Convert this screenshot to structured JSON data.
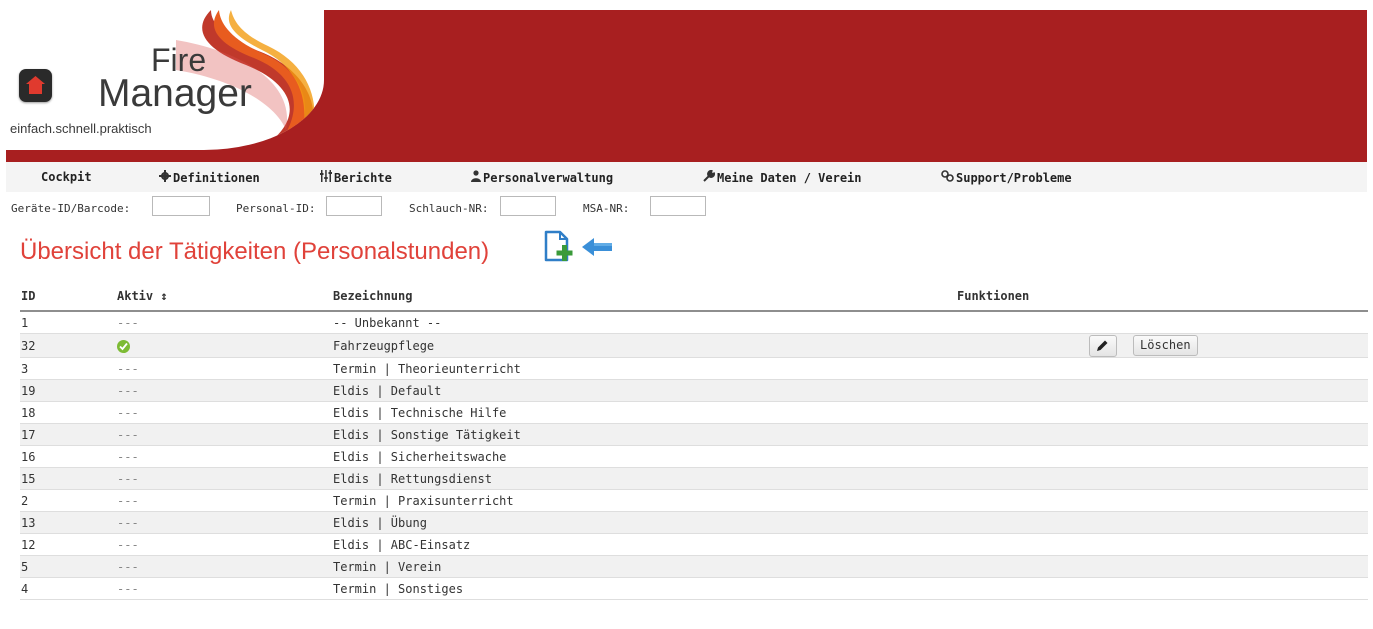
{
  "brand": {
    "line1": "Fire",
    "line2": "Manager",
    "tagline": "einfach.schnell.praktisch"
  },
  "nav": {
    "items": [
      {
        "label": "Cockpit",
        "icon": "none"
      },
      {
        "label": "Definitionen",
        "icon": "gear-icon"
      },
      {
        "label": "Berichte",
        "icon": "sliders-icon"
      },
      {
        "label": "Personalverwaltung",
        "icon": "person-icon"
      },
      {
        "label": "Meine Daten / Verein",
        "icon": "wrench-icon"
      },
      {
        "label": "Support/Probleme",
        "icon": "support-icon"
      }
    ]
  },
  "quick_search": {
    "device_label": "Geräte-ID/Barcode:",
    "device_value": "",
    "personal_label": "Personal-ID:",
    "personal_value": "",
    "hose_label": "Schlauch-NR:",
    "hose_value": "",
    "msa_label": "MSA-NR:",
    "msa_value": ""
  },
  "page": {
    "title": "Übersicht der Tätigkeiten (Personalstunden)"
  },
  "table": {
    "columns": {
      "id": "ID",
      "active": "Aktiv ↕",
      "name": "Bezeichnung",
      "functions": "Funktionen"
    },
    "edit_icon": "pencil-icon",
    "delete_label": "Löschen",
    "rows": [
      {
        "id": "1",
        "active": "---",
        "name": "-- Unbekannt --"
      },
      {
        "id": "32",
        "active": "check-icon",
        "name": "Fahrzeugpflege"
      },
      {
        "id": "3",
        "active": "---",
        "name": "Termin | Theorieunterricht"
      },
      {
        "id": "19",
        "active": "---",
        "name": "Eldis | Default"
      },
      {
        "id": "18",
        "active": "---",
        "name": "Eldis | Technische Hilfe"
      },
      {
        "id": "17",
        "active": "---",
        "name": "Eldis | Sonstige Tätigkeit"
      },
      {
        "id": "16",
        "active": "---",
        "name": "Eldis | Sicherheitswache"
      },
      {
        "id": "15",
        "active": "---",
        "name": "Eldis | Rettungsdienst"
      },
      {
        "id": "2",
        "active": "---",
        "name": "Termin | Praxisunterricht"
      },
      {
        "id": "13",
        "active": "---",
        "name": "Eldis | Übung"
      },
      {
        "id": "12",
        "active": "---",
        "name": "Eldis | ABC-Einsatz"
      },
      {
        "id": "5",
        "active": "---",
        "name": "Termin | Verein"
      },
      {
        "id": "4",
        "active": "---",
        "name": "Termin | Sonstiges"
      }
    ]
  },
  "colors": {
    "header_red": "#a81f20",
    "title_red": "#e0423a",
    "active_green": "#7dbb34",
    "add_green": "#3a9a3a",
    "back_blue": "#3a8fd8"
  }
}
